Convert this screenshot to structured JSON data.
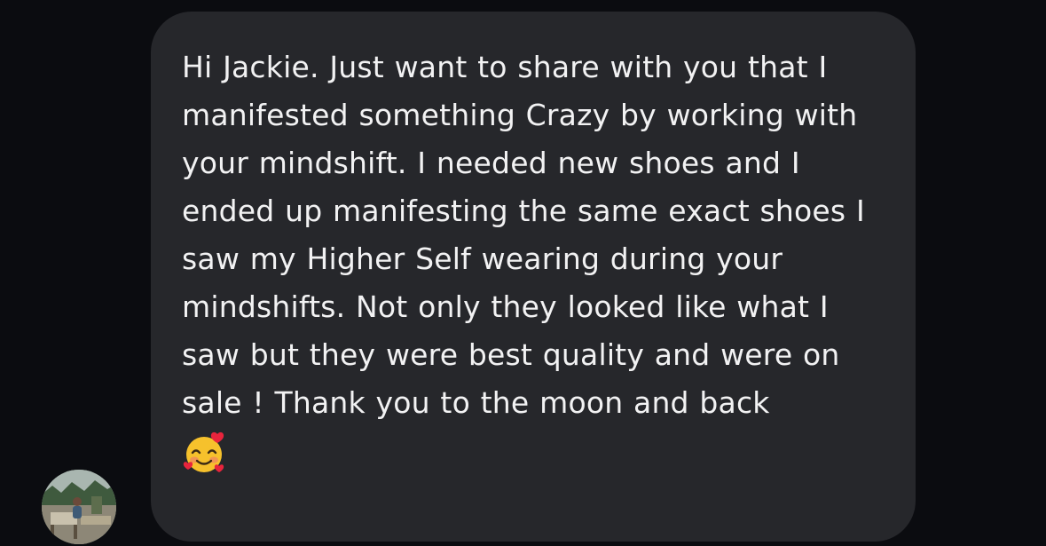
{
  "conversation": {
    "sender_avatar_icon": "profile-photo-avatar",
    "message": {
      "text": "Hi Jackie. Just want to share with you that I manifested something Crazy by working with your mindshift. I needed new shoes and I ended up manifesting the same exact shoes I saw my Higher Self wearing during your mindshifts. Not only they looked like what I saw but they were best quality and were on sale ! Thank you to the moon and back",
      "emoji": "smiling-face-with-hearts",
      "emoji_char": "🥰"
    }
  },
  "colors": {
    "background": "#0b0c10",
    "bubble": "#26272b",
    "text": "#f2f2f3"
  }
}
